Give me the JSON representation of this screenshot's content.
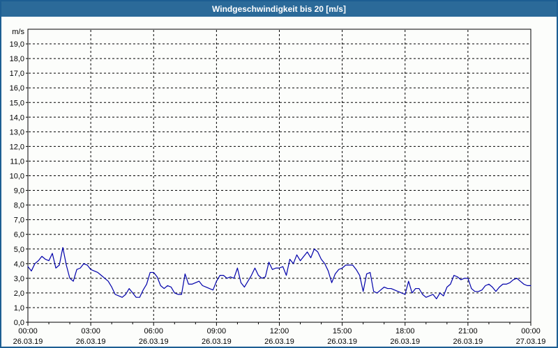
{
  "window": {
    "title": "Windgeschwindigkeit bis 20 [m/s]"
  },
  "colors": {
    "titlebar_bg": "#2b6a99",
    "window_border": "#1d5e92",
    "background": "#fcfdfb",
    "line": "#0000aa",
    "grid": "#000000",
    "text": "#000000"
  },
  "chart_data": {
    "type": "line",
    "title": "Windgeschwindigkeit bis 20 [m/s]",
    "ylabel": "m/s",
    "ylim": [
      0,
      20
    ],
    "y_tick_step": 1.0,
    "grid": "dashed",
    "legend_position": "none",
    "y_axis": {
      "label": "m/s",
      "tick_labels": [
        "0,0",
        "1,0",
        "2,0",
        "3,0",
        "4,0",
        "5,0",
        "6,0",
        "7,0",
        "8,0",
        "9,0",
        "10,0",
        "11,0",
        "12,0",
        "13,0",
        "14,0",
        "15,0",
        "16,0",
        "17,0",
        "18,0",
        "19,0"
      ]
    },
    "x_axis": {
      "hours_total": 24,
      "major_tick_hours": 3,
      "minor_tick_hours": 1,
      "ticks": [
        {
          "time": "00:00",
          "date": "26.03.19"
        },
        {
          "time": "03:00",
          "date": "26.03.19"
        },
        {
          "time": "06:00",
          "date": "26.03.19"
        },
        {
          "time": "09:00",
          "date": "26.03.19"
        },
        {
          "time": "12:00",
          "date": "26.03.19"
        },
        {
          "time": "15:00",
          "date": "26.03.19"
        },
        {
          "time": "18:00",
          "date": "26.03.19"
        },
        {
          "time": "21:00",
          "date": "26.03.19"
        },
        {
          "time": "00:00",
          "date": "27.03.19"
        }
      ]
    },
    "series": [
      {
        "name": "Windgeschwindigkeit",
        "unit": "m/s",
        "start": "26.03.19 00:00",
        "interval_minutes": 10,
        "values": [
          3.8,
          3.5,
          4.0,
          4.2,
          4.5,
          4.3,
          4.2,
          4.7,
          3.7,
          3.9,
          5.1,
          3.9,
          3.0,
          2.8,
          3.6,
          3.7,
          4.0,
          3.9,
          3.6,
          3.5,
          3.4,
          3.2,
          3.0,
          2.8,
          2.4,
          1.9,
          1.8,
          1.7,
          1.9,
          2.3,
          2.0,
          1.7,
          1.7,
          2.2,
          2.6,
          3.4,
          3.4,
          3.1,
          2.5,
          2.3,
          2.5,
          2.4,
          2.0,
          1.9,
          1.9,
          3.3,
          2.6,
          2.6,
          2.7,
          2.8,
          2.5,
          2.4,
          2.3,
          2.2,
          2.8,
          3.2,
          3.2,
          3.0,
          3.1,
          3.0,
          3.7,
          2.7,
          2.4,
          2.8,
          3.2,
          3.7,
          3.2,
          3.0,
          3.1,
          4.1,
          3.6,
          3.7,
          3.7,
          3.8,
          3.2,
          4.3,
          4.0,
          4.6,
          4.2,
          4.5,
          4.8,
          4.4,
          5.0,
          4.8,
          4.3,
          4.0,
          3.5,
          2.7,
          3.3,
          3.6,
          3.7,
          3.9,
          3.9,
          3.9,
          3.6,
          3.2,
          2.1,
          3.3,
          3.4,
          2.1,
          2.0,
          2.2,
          2.4,
          2.3,
          2.3,
          2.2,
          2.1,
          2.0,
          1.9,
          2.8,
          2.0,
          2.3,
          2.3,
          1.9,
          1.7,
          1.8,
          1.9,
          1.6,
          2.0,
          1.8,
          2.4,
          2.6,
          3.2,
          3.1,
          2.9,
          3.0,
          3.0,
          2.3,
          2.1,
          2.1,
          2.2,
          2.5,
          2.6,
          2.4,
          2.1,
          2.4,
          2.6,
          2.6,
          2.7,
          2.9,
          3.0,
          2.8,
          2.6,
          2.5,
          2.5
        ]
      }
    ]
  }
}
